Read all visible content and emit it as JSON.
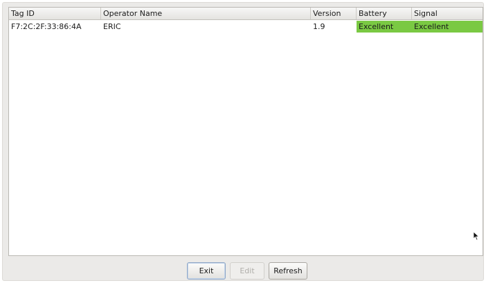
{
  "table": {
    "columns": [
      "Tag ID",
      "Operator Name",
      "Version",
      "Battery",
      "Signal"
    ],
    "rows": [
      {
        "tag_id": "F7:2C:2F:33:86:4A",
        "operator_name": "ERIC",
        "version": "1.9",
        "battery": "Excellent",
        "signal": "Excellent"
      }
    ]
  },
  "status_colors": {
    "excellent": "#7ac943"
  },
  "buttons": {
    "exit": "Exit",
    "edit": "Edit",
    "refresh": "Refresh"
  },
  "icons": {
    "cursor": "mouse-pointer-icon"
  }
}
